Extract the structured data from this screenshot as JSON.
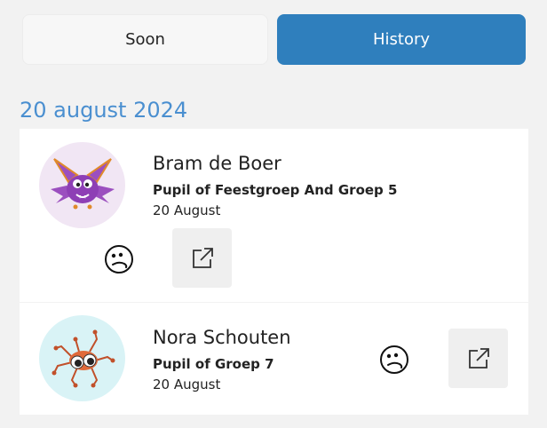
{
  "tabs": {
    "soon": "Soon",
    "history": "History",
    "active": "history"
  },
  "colors": {
    "accent": "#2f7fbd",
    "date_heading": "#4a8fd0",
    "background": "#f2f2f2"
  },
  "date_group": {
    "heading": "20 august 2024"
  },
  "entries": [
    {
      "name": "Bram de Boer",
      "role": "Pupil of Feestgroep And Groep 5",
      "date": "20 August",
      "avatar": "purple-bat-monster-avatar",
      "mood_icon": "unsure-face-icon",
      "action_icon": "external-link-icon"
    },
    {
      "name": "Nora Schouten",
      "role": "Pupil of Groep 7",
      "date": "20 August",
      "avatar": "orange-spider-monster-avatar",
      "mood_icon": "unsure-face-icon",
      "action_icon": "external-link-icon"
    }
  ]
}
